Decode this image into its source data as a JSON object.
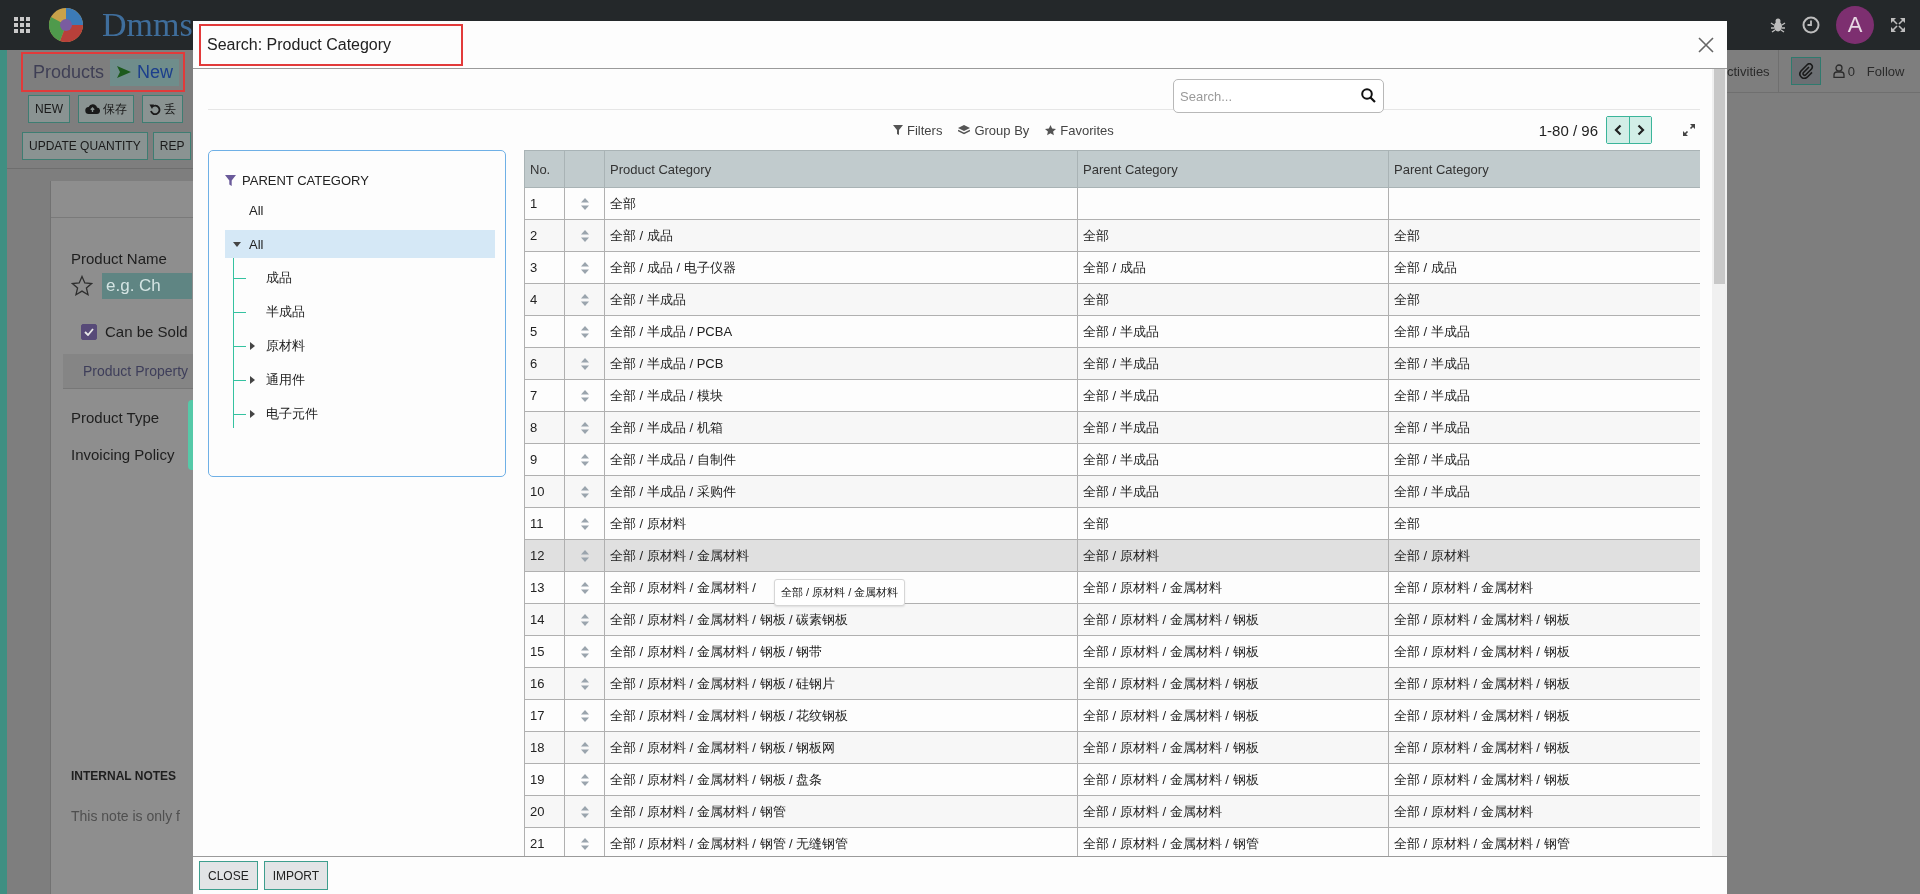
{
  "navbar": {
    "logo_text": "Dmms",
    "avatar": "A"
  },
  "breadcrumb": {
    "parent": "Products",
    "current": "New",
    "highlighted": true
  },
  "form_buttons": [
    {
      "label": "NEW",
      "kind": "plain"
    },
    {
      "label": "保存",
      "kind": "save"
    },
    {
      "label": "丢",
      "kind": "discard"
    }
  ],
  "action_buttons": [
    "UPDATE QUANTITY",
    "REP"
  ],
  "chatter": {
    "activities": "ctivities",
    "followers": "0",
    "follow": "Follow"
  },
  "form": {
    "name_label": "Product Name",
    "name_placeholder": "e.g. Ch",
    "can_be_sold": {
      "label": "Can be Sold",
      "checked": true
    },
    "tab": "Product Property",
    "fields": [
      "Product Type",
      "Invoicing Policy"
    ],
    "notes_heading": "INTERNAL NOTES",
    "notes_text": "This note is only f"
  },
  "dialog": {
    "title": "Search: Product Category",
    "title_highlighted": true,
    "search": {
      "placeholder": "Search..."
    },
    "toolbar": [
      {
        "label": "Filters",
        "kind": "filter"
      },
      {
        "label": "Group By",
        "kind": "group"
      },
      {
        "label": "Favorites",
        "kind": "favorite"
      }
    ],
    "pager": "1-80 / 96",
    "sidebar": {
      "heading": "PARENT CATEGORY",
      "items": [
        {
          "label": "All",
          "selected": false,
          "expandable": false,
          "expanded": false
        },
        {
          "label": "All",
          "selected": true,
          "expandable": true,
          "expanded": true,
          "children": [
            {
              "label": "成品",
              "selected": false,
              "expandable": false,
              "expanded": false
            },
            {
              "label": "半成品",
              "selected": false,
              "expandable": false,
              "expanded": false
            },
            {
              "label": "原材料",
              "selected": false,
              "expandable": true,
              "expanded": false
            },
            {
              "label": "通用件",
              "selected": false,
              "expandable": true,
              "expanded": false
            },
            {
              "label": "电子元件",
              "selected": false,
              "expandable": true,
              "expanded": false
            }
          ]
        }
      ]
    },
    "table": {
      "columns": [
        "No.",
        "Product Category",
        "Parent Category",
        "Parent Category"
      ],
      "rows": [
        {
          "no": "1",
          "category": "全部",
          "hovered": false
        },
        {
          "no": "2",
          "category": "全部 / 成品",
          "parent": "全部",
          "parent_2": "全部",
          "hovered": false
        },
        {
          "no": "3",
          "category": "全部 / 成品 / 电子仪器",
          "parent": "全部 / 成品",
          "parent_2": "全部 / 成品",
          "hovered": false
        },
        {
          "no": "4",
          "category": "全部 / 半成品",
          "parent": "全部",
          "parent_2": "全部",
          "hovered": false
        },
        {
          "no": "5",
          "category": "全部 / 半成品 / PCBA",
          "parent": "全部 / 半成品",
          "parent_2": "全部 / 半成品",
          "hovered": false
        },
        {
          "no": "6",
          "category": "全部 / 半成品 / PCB",
          "parent": "全部 / 半成品",
          "parent_2": "全部 / 半成品",
          "hovered": false
        },
        {
          "no": "7",
          "category": "全部 / 半成品 / 模块",
          "parent": "全部 / 半成品",
          "parent_2": "全部 / 半成品",
          "hovered": false
        },
        {
          "no": "8",
          "category": "全部 / 半成品 / 机箱",
          "parent": "全部 / 半成品",
          "parent_2": "全部 / 半成品",
          "hovered": false
        },
        {
          "no": "9",
          "category": "全部 / 半成品 / 自制件",
          "parent": "全部 / 半成品",
          "parent_2": "全部 / 半成品",
          "hovered": false
        },
        {
          "no": "10",
          "category": "全部 / 半成品 / 采购件",
          "parent": "全部 / 半成品",
          "parent_2": "全部 / 半成品",
          "hovered": false
        },
        {
          "no": "11",
          "category": "全部 / 原材料",
          "parent": "全部",
          "parent_2": "全部",
          "hovered": false
        },
        {
          "no": "12",
          "category": "全部 / 原材料 / 金属材料",
          "parent": "全部 / 原材料",
          "parent_2": "全部 / 原材料",
          "hovered": true
        },
        {
          "no": "13",
          "category": "全部 / 原材料 / 金属材料 /",
          "parent": "全部 / 原材料 / 金属材料",
          "parent_2": "全部 / 原材料 / 金属材料",
          "hovered": false
        },
        {
          "no": "14",
          "category": "全部 / 原材料 / 金属材料 / 钢板 / 碳素钢板",
          "parent": "全部 / 原材料 / 金属材料 / 钢板",
          "parent_2": "全部 / 原材料 / 金属材料 / 钢板",
          "hovered": false
        },
        {
          "no": "15",
          "category": "全部 / 原材料 / 金属材料 / 钢板 / 钢带",
          "parent": "全部 / 原材料 / 金属材料 / 钢板",
          "parent_2": "全部 / 原材料 / 金属材料 / 钢板",
          "hovered": false
        },
        {
          "no": "16",
          "category": "全部 / 原材料 / 金属材料 / 钢板 / 硅钢片",
          "parent": "全部 / 原材料 / 金属材料 / 钢板",
          "parent_2": "全部 / 原材料 / 金属材料 / 钢板",
          "hovered": false
        },
        {
          "no": "17",
          "category": "全部 / 原材料 / 金属材料 / 钢板 / 花纹钢板",
          "parent": "全部 / 原材料 / 金属材料 / 钢板",
          "parent_2": "全部 / 原材料 / 金属材料 / 钢板",
          "hovered": false
        },
        {
          "no": "18",
          "category": "全部 / 原材料 / 金属材料 / 钢板 / 钢板网",
          "parent": "全部 / 原材料 / 金属材料 / 钢板",
          "parent_2": "全部 / 原材料 / 金属材料 / 钢板",
          "hovered": false
        },
        {
          "no": "19",
          "category": "全部 / 原材料 / 金属材料 / 钢板 / 盘条",
          "parent": "全部 / 原材料 / 金属材料 / 钢板",
          "parent_2": "全部 / 原材料 / 金属材料 / 钢板",
          "hovered": false
        },
        {
          "no": "20",
          "category": "全部 / 原材料 / 金属材料 / 钢管",
          "parent": "全部 / 原材料 / 金属材料",
          "parent_2": "全部 / 原材料 / 金属材料",
          "hovered": false
        },
        {
          "no": "21",
          "category": "全部 / 原材料 / 金属材料 / 钢管 / 无缝钢管",
          "parent": "全部 / 原材料 / 金属材料 / 钢管",
          "parent_2": "全部 / 原材料 / 金属材料 / 钢管",
          "hovered": false
        }
      ]
    },
    "tooltip": "全部 / 原材料 / 金属材料",
    "buttons": [
      "CLOSE",
      "IMPORT"
    ]
  }
}
